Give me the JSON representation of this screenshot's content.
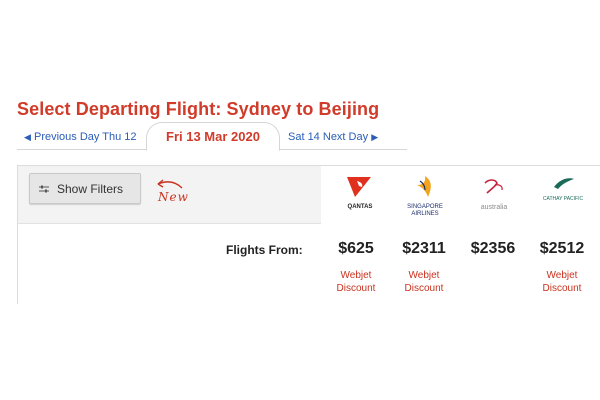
{
  "page_title": "Select Departing Flight: Sydney to Beijing",
  "day_nav": {
    "previous_label": "Previous Day",
    "previous_date": "Thu 12",
    "current_day": "Fri 13 Mar 2020",
    "next_date": "Sat 14",
    "next_label": "Next Day"
  },
  "filters": {
    "button_label": "Show Filters",
    "annotation": "New"
  },
  "airlines": [
    {
      "name": "QANTAS",
      "logo": "qantas-kangaroo-logo",
      "color": "#e0301e"
    },
    {
      "name": "SINGAPORE AIRLINES",
      "logo": "singapore-airlines-bird-logo",
      "color": "#f2a51c"
    },
    {
      "name": "australia",
      "logo": "virgin-australia-logo",
      "color": "#c41e3a"
    },
    {
      "name": "CATHAY PACIFIC",
      "logo": "cathay-pacific-brushwing-logo",
      "color": "#1a6b5a"
    }
  ],
  "fares": {
    "row_label": "Flights From:",
    "prices": [
      "$625",
      "$2311",
      "$2356",
      "$2512"
    ],
    "discount_lines": [
      "Webjet",
      "Discount"
    ]
  },
  "colors": {
    "accent_red": "#d13b2a",
    "link_blue": "#2a5db8",
    "text_dark": "#222222"
  }
}
